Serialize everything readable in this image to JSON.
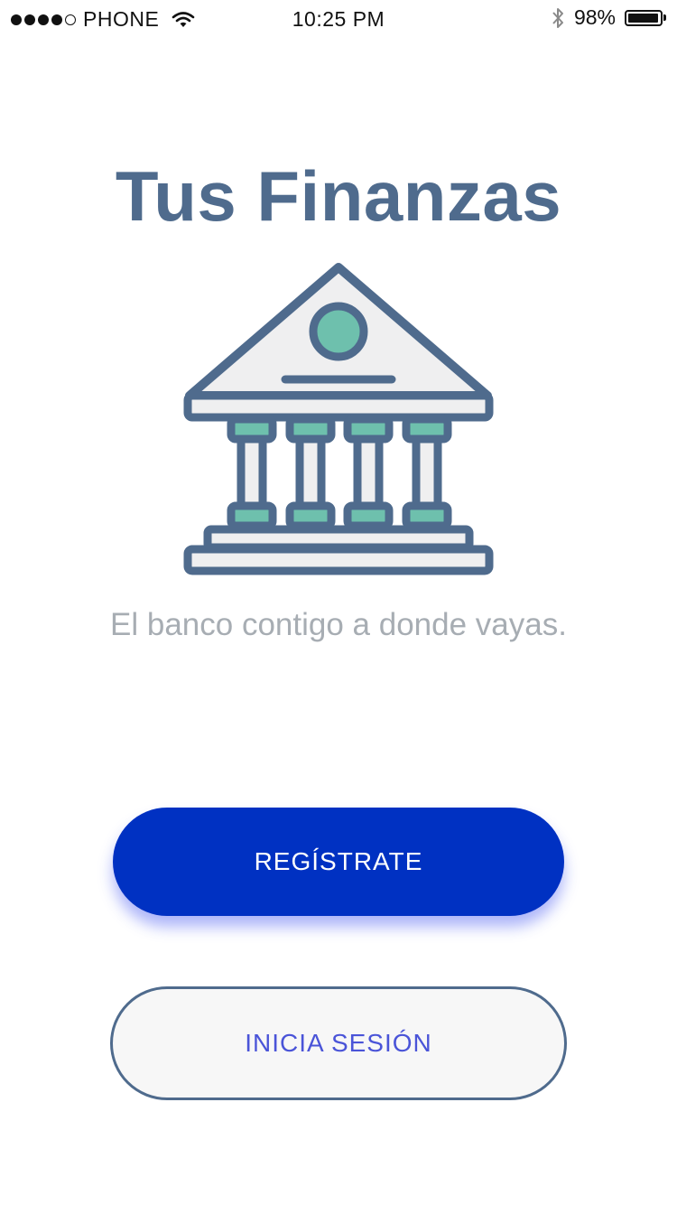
{
  "status_bar": {
    "carrier": "PHONE",
    "time": "10:25 PM",
    "battery_percent": "98%",
    "battery_level": 0.98,
    "signal_bars": 4,
    "icons": [
      "signal-dots-icon",
      "wifi-icon",
      "bluetooth-icon",
      "battery-icon"
    ]
  },
  "app": {
    "title": "Tus Finanzas",
    "illustration": "bank-building-icon",
    "tagline": "El banco contigo a donde vayas."
  },
  "actions": {
    "register_label": "REGÍSTRATE",
    "login_label": "INICIA SESIÓN"
  },
  "colors": {
    "title": "#4f6b8d",
    "illustration_stroke": "#4f6b8d",
    "illustration_accent": "#6ec0ad",
    "illustration_fill": "#efeff0",
    "primary_button": "#0031c2",
    "secondary_button_text": "#4a54d8",
    "tagline": "#a7adb3"
  }
}
